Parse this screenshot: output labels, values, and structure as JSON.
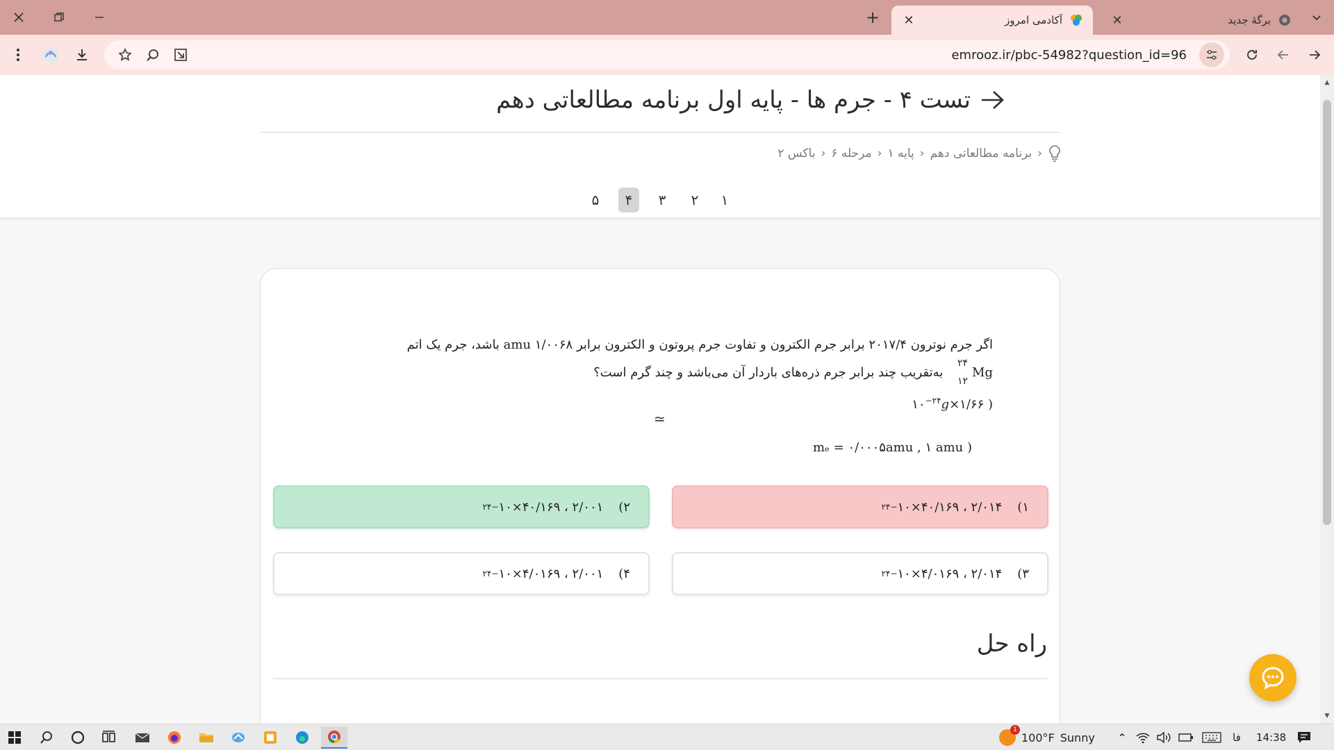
{
  "browser": {
    "tabs": [
      {
        "title": "برگهٔ جدید",
        "active": false
      },
      {
        "title": "آکادمی امروز",
        "active": true
      }
    ],
    "new_tab_glyph": "+",
    "url": "emrooz.ir/pbc-54982?question_id=96"
  },
  "page": {
    "title": "تست ۴ - جرم ها - پایه اول برنامه مطالعاتی دهم",
    "breadcrumb": [
      "برنامه مطالعاتی دهم",
      "پایه ۱",
      "مرحله ۶",
      "باکس ۲"
    ],
    "pager": {
      "items": [
        "۱",
        "۲",
        "۳",
        "۴",
        "۵"
      ],
      "active_index": 3
    },
    "question": {
      "line1_a": "اگر جرم نوترون",
      "line1_num": "۲۰۱۷/۴",
      "line1_b": "برابر جرم الکترون و تفاوت جرم پروتون و الکترون برابر",
      "line1_unit": "amu",
      "line1_val": "۱/۰۰۶۸",
      "line1_c": "باشد، جرم یک اتم",
      "mg_mass": "۲۴",
      "mg_atomic": "۱۲",
      "mg_symbol": "Mg",
      "line2": "به‌تقریب چند برابر جرم ذره‌های باردار آن می‌باشد و چند گرم است؟",
      "line3": "(  ۱/۶۶×۱۰",
      "line3_exp": "−۲۴",
      "line3_g": "g",
      "approx": "≃",
      "line4": "( mₑ = ۰/۰۰۰۵amu ,  ۱ amu"
    },
    "options": [
      {
        "num": "۱)",
        "text": "۲/۰۱۴ ،  ۴۰/۱۶۹×۱۰",
        "exp": "−۲۴",
        "state": "wrong"
      },
      {
        "num": "۲)",
        "text": "۲/۰۰۱ ،  ۴۰/۱۶۹×۱۰",
        "exp": "−۲۴",
        "state": "correct"
      },
      {
        "num": "۳)",
        "text": "۲/۰۱۴ ،  ۴/۰۱۶۹×۱۰",
        "exp": "−۲۴",
        "state": "neutral"
      },
      {
        "num": "۴)",
        "text": "۲/۰۰۱ ،  ۴/۰۱۶۹×۱۰",
        "exp": "−۲۴",
        "state": "neutral"
      }
    ],
    "solution_title": "راه حل"
  },
  "taskbar": {
    "weather_temp": "100°F",
    "weather_desc": "Sunny",
    "weather_badge": "1",
    "lang": "فا",
    "time": "14:38"
  },
  "colors": {
    "tabstrip": "#d29f9a",
    "toolbar": "#fbe4e1",
    "wrong": "#f8c8c8",
    "correct": "#bfead1",
    "chat": "#f7b21c"
  }
}
